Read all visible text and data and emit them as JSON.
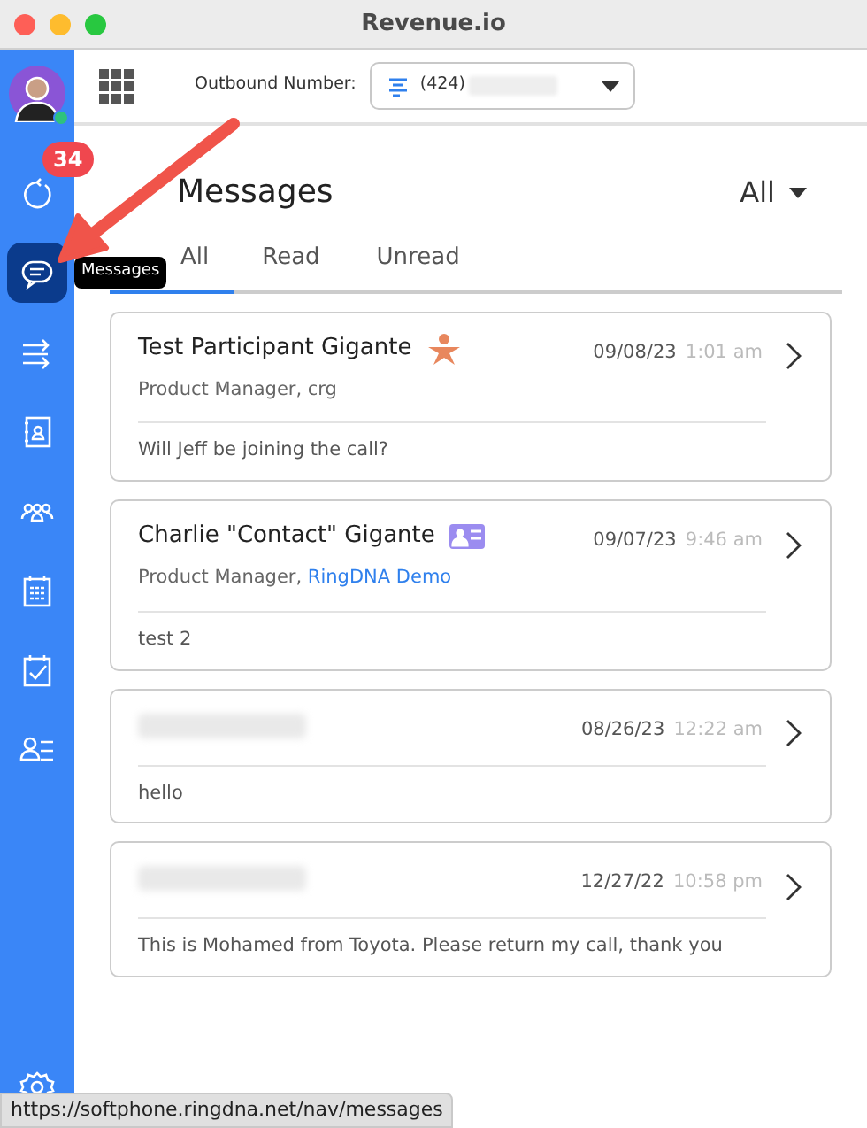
{
  "window": {
    "title": "Revenue.io"
  },
  "sidebar": {
    "items": [
      {
        "kind": "avatar",
        "online": true,
        "selected": false
      },
      {
        "kind": "refresh",
        "badge": "34",
        "selected": false
      },
      {
        "kind": "messages",
        "selected": true,
        "tooltip": "Messages"
      },
      {
        "kind": "transfer",
        "selected": false
      },
      {
        "kind": "contacts",
        "selected": false
      },
      {
        "kind": "team",
        "selected": false
      },
      {
        "kind": "calendar",
        "selected": false
      },
      {
        "kind": "tasks",
        "selected": false
      },
      {
        "kind": "list",
        "selected": false
      },
      {
        "kind": "settings",
        "selected": false
      }
    ]
  },
  "header": {
    "outbound_label": "Outbound Number:",
    "outbound_value": "(424)"
  },
  "page": {
    "title": "Messages",
    "filter": "All"
  },
  "tabs": [
    {
      "label": "All",
      "selected": true
    },
    {
      "label": "Read",
      "selected": false
    },
    {
      "label": "Unread",
      "selected": false
    }
  ],
  "messages": [
    {
      "kind": "participant",
      "name": "Test Participant Gigante",
      "role": "Product Manager, ",
      "company": "crg",
      "company_link": false,
      "date": "09/08/23",
      "time": "1:01 am",
      "body": "Will Jeff be joining the call?"
    },
    {
      "kind": "contact",
      "name": "Charlie \"Contact\" Gigante",
      "role": "Product Manager, ",
      "company": "RingDNA Demo",
      "company_link": true,
      "date": "09/07/23",
      "time": "9:46 am",
      "body": "test 2"
    },
    {
      "kind": "redacted",
      "date": "08/26/23",
      "time": "12:22 am",
      "body": "hello"
    },
    {
      "kind": "redacted",
      "date": "12/27/22",
      "time": "10:58 pm",
      "body": "This is Mohamed from Toyota. Please return my call,  thank you"
    }
  ],
  "status_bar": {
    "url": "https://softphone.ringdna.net/nav/messages"
  }
}
